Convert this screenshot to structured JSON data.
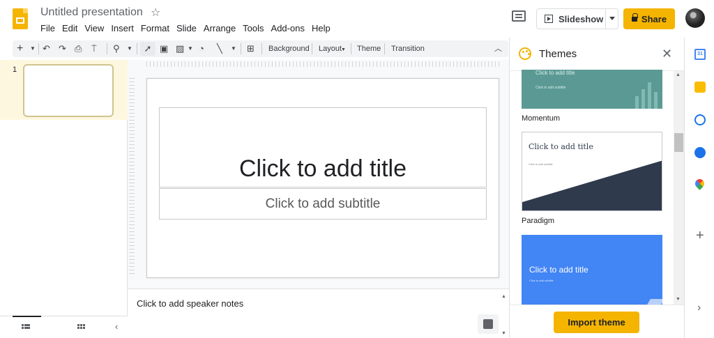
{
  "header": {
    "doc_title": "Untitled presentation",
    "menu": [
      "File",
      "Edit",
      "View",
      "Insert",
      "Format",
      "Slide",
      "Arrange",
      "Tools",
      "Add-ons",
      "Help"
    ],
    "slideshow_label": "Slideshow",
    "share_label": "Share",
    "accent": "#f4b400"
  },
  "toolbar": {
    "background_label": "Background",
    "layout_label": "Layout",
    "theme_label": "Theme",
    "transition_label": "Transition"
  },
  "filmstrip": {
    "slide_number": "1"
  },
  "slide": {
    "title_placeholder": "Click to add title",
    "subtitle_placeholder": "Click to add subtitle"
  },
  "notes": {
    "placeholder": "Click to add speaker notes"
  },
  "themes_panel": {
    "title": "Themes",
    "themes": [
      {
        "name": "Momentum",
        "title_text": "Click to add title",
        "subtitle_text": "Click to add subtitle",
        "color": "#5b9a94"
      },
      {
        "name": "Paradigm",
        "title_text": "Click to add title",
        "subtitle_text": "Click to add subtitle",
        "color": "#303a4d"
      },
      {
        "name": "",
        "title_text": "Click to add title",
        "subtitle_text": "Click to add subtitle",
        "color": "#4285f4"
      }
    ],
    "import_label": "Import theme"
  }
}
